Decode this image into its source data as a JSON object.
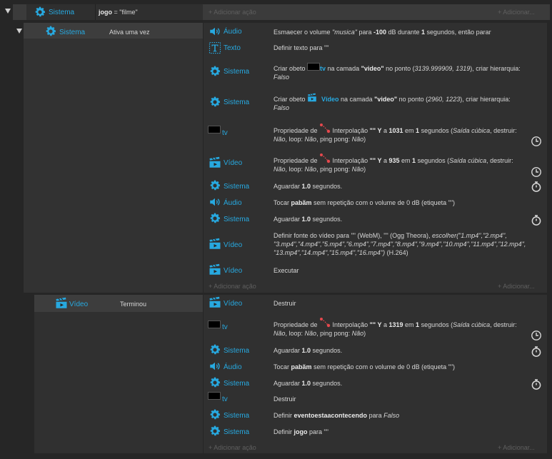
{
  "colors": {
    "object": "#27a9e0",
    "tween": "#e5484d",
    "background": "#262626"
  },
  "top_event": {
    "object": "Sistema",
    "condition_prefix": "jogo",
    "condition_suffix": " = \"filme\"",
    "add_action": "Adicionar ação",
    "add_more": "Adicionar..."
  },
  "sub1": {
    "object": "Sistema",
    "condition": "Ativa uma vez",
    "add_action": "Adicionar ação",
    "add_more": "Adicionar...",
    "actions": [
      {
        "object": "Áudio",
        "p1": "Esmaecer o volume ",
        "v1": "\"musica\"",
        "p2": " para ",
        "b1": "-100",
        "p3": " dB durante ",
        "b2": "1",
        "p4": " segundos, então parar"
      },
      {
        "object": "Texto",
        "text": "Definir texto para \"\""
      },
      {
        "p1": "Criar obeto ",
        "inner": "tv",
        "p2": " na camada ",
        "b1": "\"video\"",
        "p3": " no ponto (",
        "i1": "3139.999909, 1319",
        "p4": "), criar hierarquia:",
        "i2": "Falso",
        "object": "Sistema"
      },
      {
        "p1": "Criar obeto ",
        "inner": "Vídeo",
        "p2": " na camada ",
        "b1": "\"video\"",
        "p3": " no ponto (",
        "i1": "2960, 1223",
        "p4": "), criar hierarquia:",
        "i2": "Falso",
        "object": "Sistema"
      },
      {
        "object": "tv",
        "p1": "Propriedade de ",
        "p2": " Interpolação ",
        "b1": "\"\"",
        "b2": " Y",
        "p3": " a ",
        "b3": "1031",
        "p4": " em ",
        "b4": "1",
        "p5": " segundos (",
        "i1": "Saída cúbica",
        "p6": ", destruir:",
        "i2": "Não",
        "p7": ", loop: ",
        "i3": "Não",
        "p8": ", ping pong: ",
        "i4": "Não",
        "p9": ")"
      },
      {
        "object": "Vídeo",
        "p1": "Propriedade de ",
        "p2": " Interpolação ",
        "b1": "\"\"",
        "b2": " Y",
        "p3": " a ",
        "b3": "935",
        "p4": " em ",
        "b4": "1",
        "p5": " segundos (",
        "i1": "Saída cúbica",
        "p6": ", destruir:",
        "i2": "Não",
        "p7": ", loop: ",
        "i3": "Não",
        "p8": ", ping pong: ",
        "i4": "Não",
        "p9": ")"
      },
      {
        "object": "Sistema",
        "p1": "Aguardar ",
        "b1": "1.0",
        "p2": " segundos."
      },
      {
        "object": "Áudio",
        "p1": "Tocar ",
        "b1": "pabãm",
        "p2": " sem repetição com o volume de 0 dB (etiqueta \"\")"
      },
      {
        "object": "Sistema",
        "p1": "Aguardar ",
        "b1": "1.0",
        "p2": " segundos."
      },
      {
        "object": "Vídeo",
        "l1p1": "Definir fonte do vídeo para \"\" (WebM), \"\" (Ogg Theora), ",
        "l1i1": "escolher(\"1.mp4\",\"2.mp4\",",
        "l2": "\"3.mp4\",\"4.mp4\",\"5.mp4\",\"6.mp4\",\"7.mp4\",\"8.mp4\",\"9.mp4\",\"10.mp4\",\"11.mp4\",\"12.mp4\",",
        "l3i": "\"13.mp4\",\"14.mp4\",\"15.mp4\",\"16.mp4\")",
        "l3p": " (H.264)"
      },
      {
        "object": "Vídeo",
        "text": "Executar"
      }
    ]
  },
  "sub2": {
    "object": "Vídeo",
    "condition": "Terminou",
    "add_action": "Adicionar ação",
    "add_more": "Adicionar...",
    "actions": [
      {
        "object": "Vídeo",
        "text": "Destruir"
      },
      {
        "object": "tv",
        "p1": "Propriedade de ",
        "p2": " Interpolação ",
        "b1": "\"\"",
        "b2": " Y",
        "p3": " a ",
        "b3": "1319",
        "p4": " em ",
        "b4": "1",
        "p5": " segundos (",
        "i1": "Saída cúbica",
        "p6": ", destruir:",
        "i2": "Não",
        "p7": ", loop: ",
        "i3": "Não",
        "p8": ", ping pong: ",
        "i4": "Não",
        "p9": ")"
      },
      {
        "object": "Sistema",
        "p1": "Aguardar ",
        "b1": "1.0",
        "p2": " segundos."
      },
      {
        "object": "Áudio",
        "p1": "Tocar ",
        "b1": "pabãm",
        "p2": " sem repetição com o volume de 0 dB (etiqueta \"\")"
      },
      {
        "object": "Sistema",
        "p1": "Aguardar ",
        "b1": "1.0",
        "p2": " segundos."
      },
      {
        "object": "tv",
        "text": "Destruir"
      },
      {
        "object": "Sistema",
        "p1": "Definir ",
        "b1": "eventoestaacontecendo",
        "p2": " para ",
        "i1": "Falso"
      },
      {
        "object": "Sistema",
        "p1": "Definir ",
        "b1": "jogo",
        "p2": " para \"\""
      }
    ]
  }
}
